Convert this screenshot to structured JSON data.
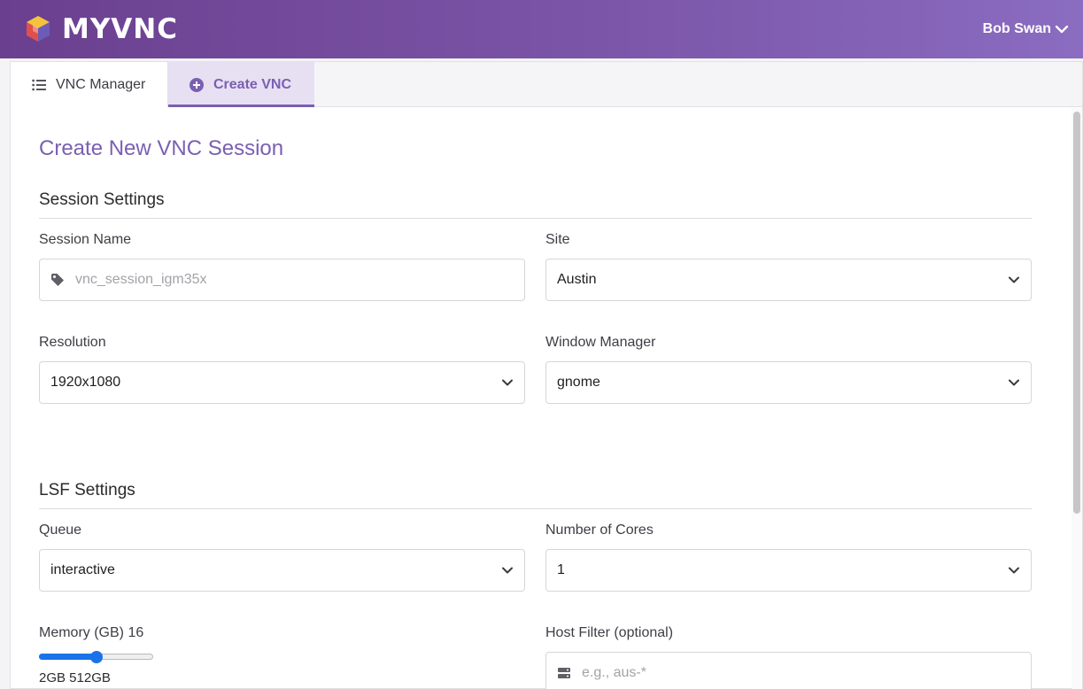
{
  "header": {
    "app_name": "MYVNC",
    "user_name": "Bob Swan"
  },
  "tabs": [
    {
      "label": "VNC Manager",
      "icon": "list-icon",
      "active": false
    },
    {
      "label": "Create VNC",
      "icon": "plus-circle-icon",
      "active": true
    }
  ],
  "page": {
    "title": "Create New VNC Session"
  },
  "session_settings": {
    "heading": "Session Settings",
    "session_name": {
      "label": "Session Name",
      "placeholder": "vnc_session_igm35x",
      "value": ""
    },
    "site": {
      "label": "Site",
      "value": "Austin"
    },
    "resolution": {
      "label": "Resolution",
      "value": "1920x1080"
    },
    "window_manager": {
      "label": "Window Manager",
      "value": "gnome"
    }
  },
  "lsf_settings": {
    "heading": "LSF Settings",
    "queue": {
      "label": "Queue",
      "value": "interactive"
    },
    "cores": {
      "label": "Number of Cores",
      "value": "1"
    },
    "memory": {
      "label": "Memory (GB) 16",
      "value": 16,
      "min": 2,
      "max": 512,
      "fraction": 0.5,
      "range_text": "2GB 512GB"
    },
    "host_filter": {
      "label": "Host Filter (optional)",
      "placeholder": "e.g., aus-*",
      "value": ""
    }
  },
  "colors": {
    "accent": "#7b5fb1",
    "header_gradient_start": "#6b3f8f",
    "header_gradient_end": "#8a6cc0",
    "slider": "#1a73e8"
  }
}
